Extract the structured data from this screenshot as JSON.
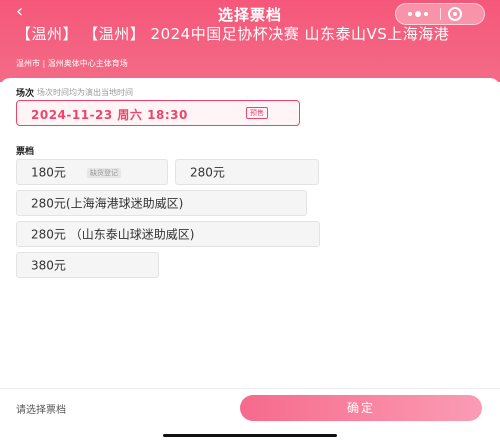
{
  "nav": {
    "back_icon": "‹",
    "title": "选择票档"
  },
  "event": {
    "title": "【温州】 【温州】 2024中国足协杯决赛 山东泰山VS上海海港",
    "venue": "温州市 | 温州奥体中心主体育场"
  },
  "session": {
    "label": "场次",
    "hint": "场次时间均为演出当地时间",
    "selected": "2024-11-23 周六 18:30",
    "badge": "预售"
  },
  "tickets": {
    "label": "票档",
    "options": [
      {
        "price": "180元",
        "tag": "缺货登记"
      },
      {
        "price": "280元"
      },
      {
        "price": "280元(上海海港球迷助威区)"
      },
      {
        "price": "280元 （山东泰山球迷助威区)"
      },
      {
        "price": "380元"
      }
    ]
  },
  "footer": {
    "hint": "请选择票档",
    "confirm": "确定"
  },
  "colors": {
    "accent": "#f0446b",
    "header_gradient_start": "#f5577a",
    "confirm_gradient_end": "#fb9cb4"
  }
}
